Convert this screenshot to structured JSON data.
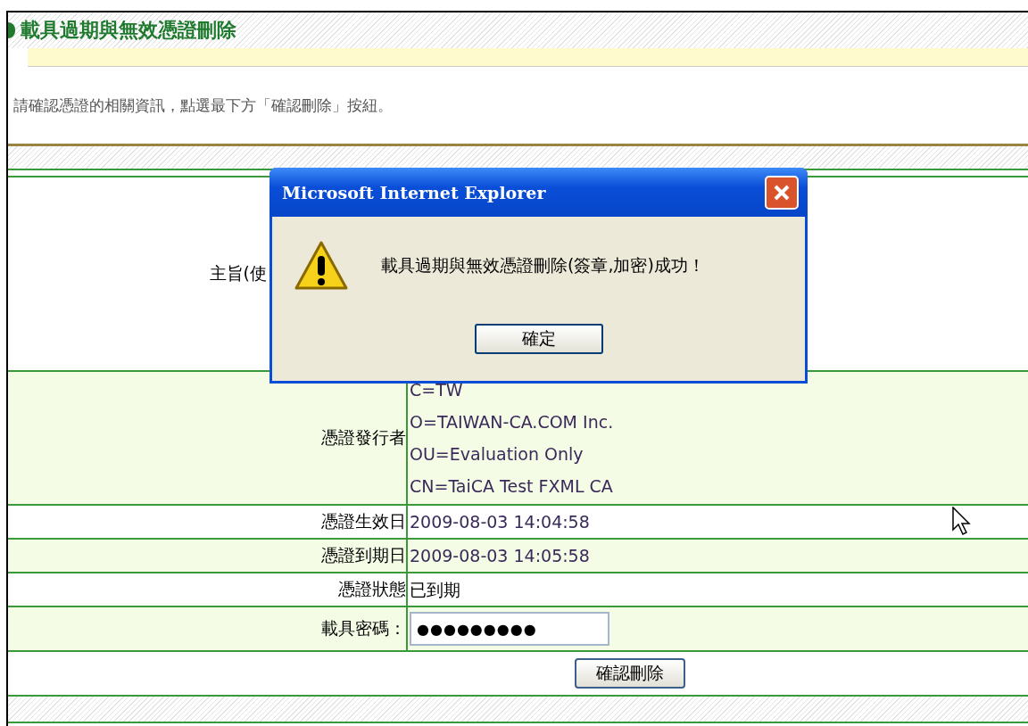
{
  "page": {
    "title": "載具過期與無效憑證刪除",
    "instruction": "請確認憑證的相關資訊，點選最下方「確認刪除」按紐。"
  },
  "rows": [
    {
      "kind": "subject",
      "label": "主旨(使",
      "values": []
    },
    {
      "kind": "text",
      "label": "憑證發行者",
      "values": [
        "C=TW",
        "O=TAIWAN-CA.COM Inc.",
        "OU=Evaluation Only",
        "CN=TaiCA Test FXML CA"
      ]
    },
    {
      "kind": "text",
      "label": "憑證生效日",
      "values": [
        "2009-08-03 14:04:58"
      ]
    },
    {
      "kind": "text",
      "label": "憑證到期日",
      "values": [
        "2009-08-03 14:05:58"
      ]
    },
    {
      "kind": "status",
      "label": "憑證狀態",
      "values": [
        "已到期"
      ]
    },
    {
      "kind": "password",
      "label": "載具密碼：",
      "values": [
        "●●●●●●●●●"
      ]
    }
  ],
  "confirm_button": "確認刪除",
  "dialog": {
    "title": "Microsoft Internet Explorer",
    "message": "載具過期與無效憑證刪除(簽章,加密)成功！",
    "ok_button": "確定"
  }
}
